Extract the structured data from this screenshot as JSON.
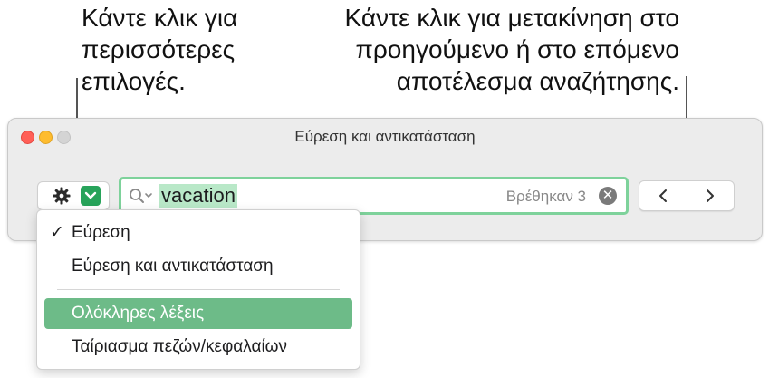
{
  "callouts": {
    "left": [
      "Κάντε κλικ για",
      "περισσότερες",
      "επιλογές."
    ],
    "right": [
      "Κάντε κλικ για μετακίνηση στο",
      "προηγούμενο ή στο επόμενο",
      "αποτέλεσμα αναζήτησης."
    ]
  },
  "window": {
    "title": "Εύρεση και αντικατάσταση"
  },
  "search": {
    "value": "vacation",
    "found": "Βρέθηκαν 3",
    "clear_glyph": "✕"
  },
  "menu": {
    "items": [
      {
        "check": "✓",
        "label": "Εύρεση"
      },
      {
        "check": "",
        "label": "Εύρεση και αντικατάσταση"
      },
      {
        "check": "",
        "label": "Ολόκληρες λέξεις"
      },
      {
        "check": "",
        "label": "Ταίριασμα πεζών/κεφαλαίων"
      }
    ]
  },
  "colors": {
    "accent": "#27a35a",
    "highlight": "#6dbb88",
    "search_focus_ring": "#7ed29b"
  }
}
